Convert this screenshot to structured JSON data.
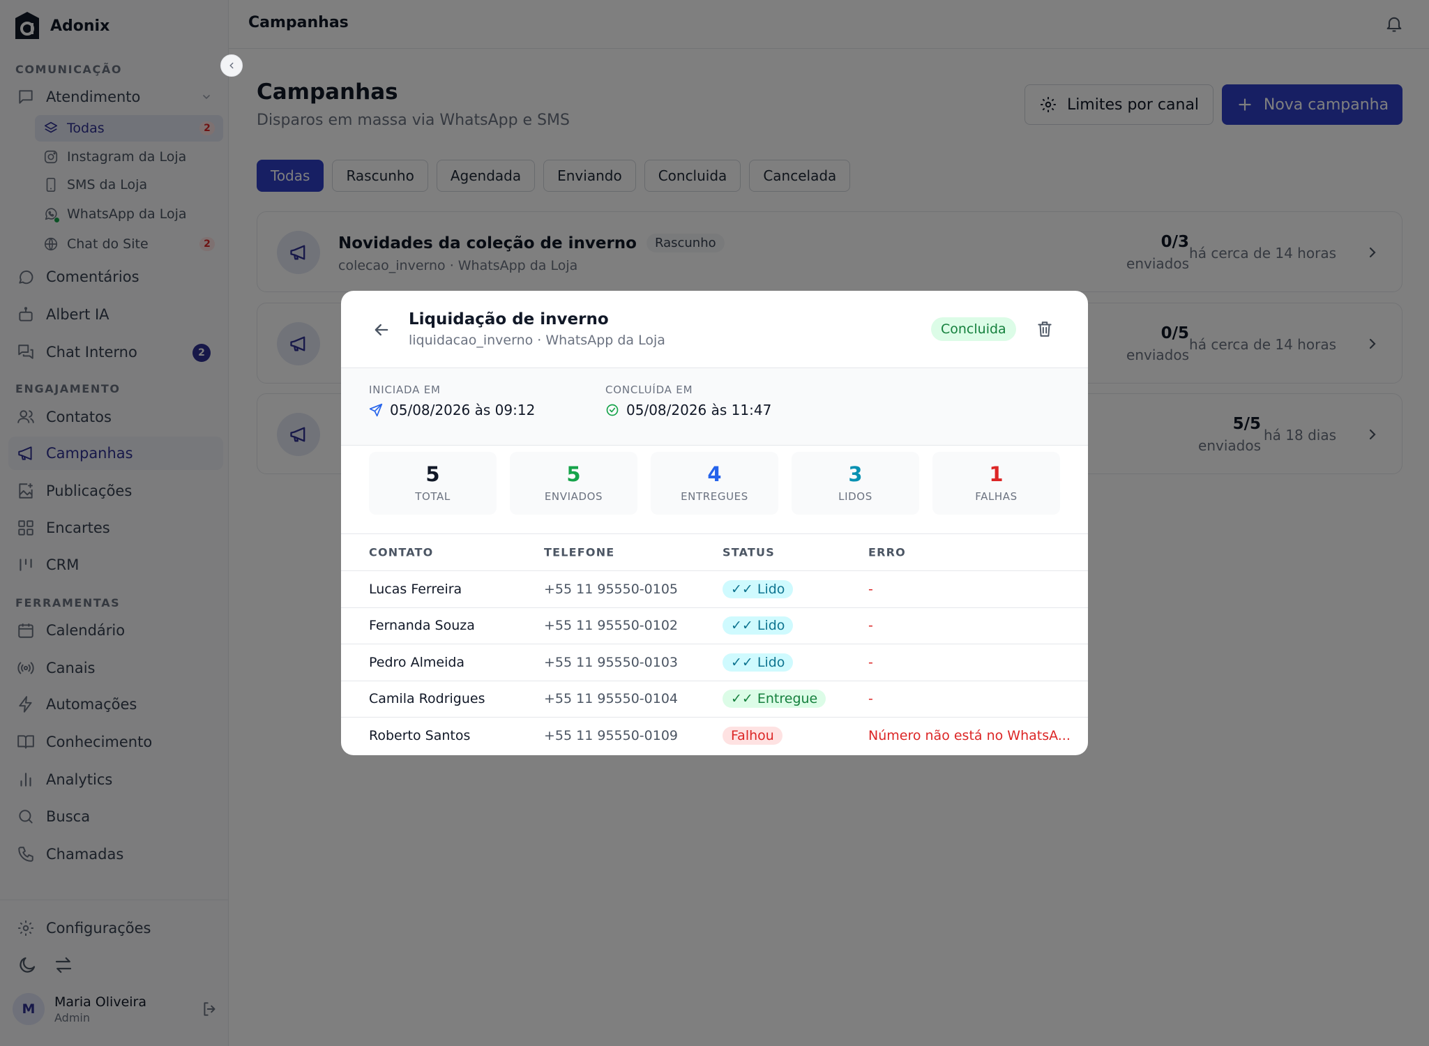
{
  "brand": {
    "name": "Adonix"
  },
  "sidebar": {
    "sections": {
      "comunicacao": "COMUNICAÇÃO",
      "engajamento": "ENGAJAMENTO",
      "ferramentas": "FERRAMENTAS"
    },
    "atendimento": {
      "label": "Atendimento",
      "icon": "message-square-icon"
    },
    "sub_items": [
      {
        "label": "Todas",
        "badge": "2",
        "icon": "layers-icon",
        "active": true
      },
      {
        "label": "Instagram da Loja",
        "icon": "instagram-icon"
      },
      {
        "label": "SMS da Loja",
        "icon": "smartphone-icon"
      },
      {
        "label": "WhatsApp da Loja",
        "icon": "whatsapp-icon"
      },
      {
        "label": "Chat do Site",
        "badge": "2",
        "icon": "globe-icon"
      }
    ],
    "items": [
      {
        "label": "Comentários",
        "icon": "message-circle-icon"
      },
      {
        "label": "Albert IA",
        "icon": "bot-icon"
      },
      {
        "label": "Chat Interno",
        "badge": "2",
        "icon": "messages-icon"
      },
      {
        "label": "Contatos",
        "icon": "users-icon"
      },
      {
        "label": "Campanhas",
        "icon": "megaphone-icon",
        "active": true
      },
      {
        "label": "Publicações",
        "icon": "image-plus-icon"
      },
      {
        "label": "Encartes",
        "icon": "grid-icon"
      },
      {
        "label": "CRM",
        "icon": "kanban-icon"
      },
      {
        "label": "Calendário",
        "icon": "calendar-icon"
      },
      {
        "label": "Canais",
        "icon": "radio-icon"
      },
      {
        "label": "Automações",
        "icon": "zap-icon"
      },
      {
        "label": "Conhecimento",
        "icon": "book-icon"
      },
      {
        "label": "Analytics",
        "icon": "bar-chart-icon"
      },
      {
        "label": "Busca",
        "icon": "search-icon"
      },
      {
        "label": "Chamadas",
        "icon": "phone-icon"
      },
      {
        "label": "Configurações",
        "icon": "gear-icon"
      }
    ],
    "user": {
      "initial": "M",
      "name": "Maria Oliveira",
      "role": "Admin"
    }
  },
  "header": {
    "title": "Campanhas"
  },
  "page": {
    "title": "Campanhas",
    "subtitle": "Disparos em massa via WhatsApp e SMS",
    "limits_button": "Limites por canal",
    "new_button": "Nova campanha",
    "filters": [
      "Todas",
      "Rascunho",
      "Agendada",
      "Enviando",
      "Concluida",
      "Cancelada"
    ],
    "active_filter": "Todas"
  },
  "campaigns": [
    {
      "title": "Novidades da coleção de inverno",
      "status": "Rascunho",
      "sub": "colecao_inverno · WhatsApp da Loja",
      "count": "0/3",
      "count_label": "enviados",
      "time": "há cerca de 14 horas"
    },
    {
      "title": "",
      "status": "",
      "sub": "",
      "count": "0/5",
      "count_label": "enviados",
      "time": "há cerca de 14 horas"
    },
    {
      "title": "",
      "status": "",
      "sub": "",
      "count": "5/5",
      "count_label": "enviados",
      "time": "há 18 dias"
    }
  ],
  "modal": {
    "title": "Liquidação de inverno",
    "subtitle": "liquidacao_inverno · WhatsApp da Loja",
    "status": "Concluida",
    "started_label": "INICIADA EM",
    "started_value": "05/08/2026 às 09:12",
    "finished_label": "CONCLUÍDA EM",
    "finished_value": "05/08/2026 às 11:47",
    "stats": [
      {
        "value": "5",
        "label": "TOTAL",
        "color": "#111827"
      },
      {
        "value": "5",
        "label": "ENVIADOS",
        "color": "#16a34a"
      },
      {
        "value": "4",
        "label": "ENTREGUES",
        "color": "#2563eb"
      },
      {
        "value": "3",
        "label": "LIDOS",
        "color": "#0891b2"
      },
      {
        "value": "1",
        "label": "FALHAS",
        "color": "#dc2626"
      }
    ],
    "table": {
      "headers": [
        "CONTATO",
        "TELEFONE",
        "STATUS",
        "ERRO"
      ],
      "rows": [
        {
          "contact": "Lucas Ferreira",
          "phone": "+55 11 95550-0105",
          "status": "✓✓ Lido",
          "status_type": "lido",
          "error": "-"
        },
        {
          "contact": "Fernanda Souza",
          "phone": "+55 11 95550-0102",
          "status": "✓✓ Lido",
          "status_type": "lido",
          "error": "-"
        },
        {
          "contact": "Pedro Almeida",
          "phone": "+55 11 95550-0103",
          "status": "✓✓ Lido",
          "status_type": "lido",
          "error": "-"
        },
        {
          "contact": "Camila Rodrigues",
          "phone": "+55 11 95550-0104",
          "status": "✓✓ Entregue",
          "status_type": "entregue",
          "error": "-"
        },
        {
          "contact": "Roberto Santos",
          "phone": "+55 11 95550-0109",
          "status": "Falhou",
          "status_type": "falhou",
          "error": "Número não está no WhatsA..."
        }
      ]
    }
  },
  "colors": {
    "accent": "#2e3fc7",
    "sidebar_active": "#2e3192",
    "success": "#16a34a",
    "danger": "#dc2626"
  }
}
